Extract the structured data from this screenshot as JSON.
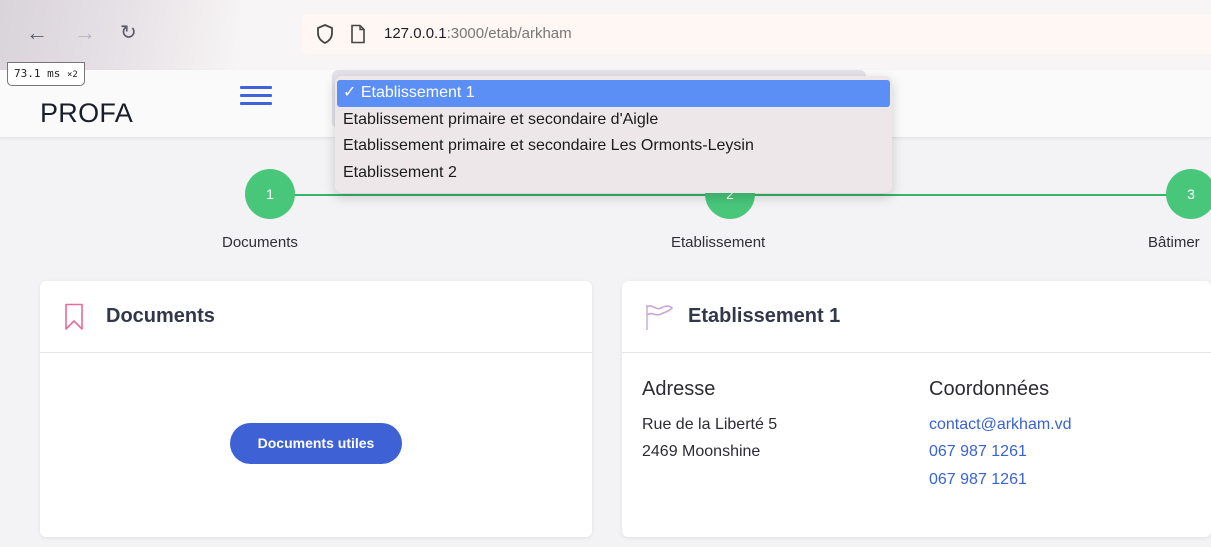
{
  "browser": {
    "url_host": "127.0.0.1",
    "url_rest": ":3000/etab/arkham",
    "perf_value": "73.1",
    "perf_unit": "ms",
    "perf_mult": "×2"
  },
  "header": {
    "brand": "PROFA"
  },
  "dropdown": {
    "options": [
      "✓ Etablissement 1",
      "Etablissement primaire et secondaire d'Aigle",
      "Etablissement primaire et secondaire Les Ormonts-Leysin",
      "Etablissement 2"
    ]
  },
  "stepper": {
    "steps": [
      {
        "number": "1",
        "label": "Documents"
      },
      {
        "number": "2",
        "label": "Etablissement"
      },
      {
        "number": "3",
        "label": "Bâtimer"
      }
    ]
  },
  "documents_card": {
    "title": "Documents",
    "button_label": "Documents utiles"
  },
  "etab_card": {
    "title": "Etablissement 1",
    "address_heading": "Adresse",
    "address_lines": [
      "Rue de la Liberté 5",
      "2469 Moonshine"
    ],
    "contact_heading": "Coordonnées",
    "email": "contact@arkham.vd",
    "phones": [
      "067 987 1261",
      "067 987 1261"
    ]
  },
  "colors": {
    "accent": "#3f61d6",
    "step_green": "#48c77a",
    "selected_option": "#5b8ff5"
  }
}
